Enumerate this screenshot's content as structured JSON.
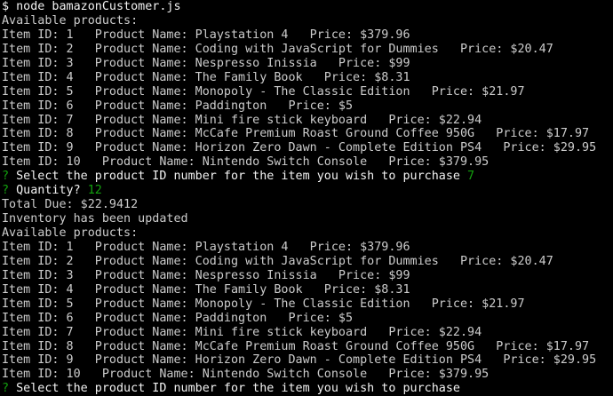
{
  "window": {
    "background": "#000000",
    "text_color": "#cccccc",
    "prompt_color": "#13a10e"
  },
  "command": {
    "prompt": "$",
    "text": "node bamazonCustomer.js"
  },
  "blocks": [
    {
      "heading": "Available products:",
      "items": [
        "Item ID: 1   Product Name: Playstation 4   Price: $379.96",
        "Item ID: 2   Product Name: Coding with JavaScript for Dummies   Price: $20.47",
        "Item ID: 3   Product Name: Nespresso Inissia   Price: $99",
        "Item ID: 4   Product Name: The Family Book   Price: $8.31",
        "Item ID: 5   Product Name: Monopoly - The Classic Edition   Price: $21.97",
        "Item ID: 6   Product Name: Paddington   Price: $5",
        "Item ID: 7   Product Name: Mini fire stick keyboard   Price: $22.94",
        "Item ID: 8   Product Name: McCafe Premium Roast Ground Coffee 950G   Price: $17.97",
        "Item ID: 9   Product Name: Horizon Zero Dawn - Complete Edition PS4   Price: $29.95",
        "Item ID: 10   Product Name: Nintendo Switch Console   Price: $379.95"
      ]
    },
    {
      "heading": "Available products:",
      "items": [
        "Item ID: 1   Product Name: Playstation 4   Price: $379.96",
        "Item ID: 2   Product Name: Coding with JavaScript for Dummies   Price: $20.47",
        "Item ID: 3   Product Name: Nespresso Inissia   Price: $99",
        "Item ID: 4   Product Name: The Family Book   Price: $8.31",
        "Item ID: 5   Product Name: Monopoly - The Classic Edition   Price: $21.97",
        "Item ID: 6   Product Name: Paddington   Price: $5",
        "Item ID: 7   Product Name: Mini fire stick keyboard   Price: $22.94",
        "Item ID: 8   Product Name: McCafe Premium Roast Ground Coffee 950G   Price: $17.97",
        "Item ID: 9   Product Name: Horizon Zero Dawn - Complete Edition PS4   Price: $29.95",
        "Item ID: 10   Product Name: Nintendo Switch Console   Price: $379.95"
      ]
    }
  ],
  "purchase": {
    "question_mark": "?",
    "id_prompt": "Select the product ID number for the item you wish to purchase",
    "id_answer": "7",
    "quantity_prompt": "Quantity?",
    "quantity_answer": "12",
    "total_due": "Total Due: $22.9412",
    "inventory_message": "Inventory has been updated"
  },
  "final_prompt": {
    "question_mark": "?",
    "text": "Select the product ID number for the item you wish to purchase"
  }
}
